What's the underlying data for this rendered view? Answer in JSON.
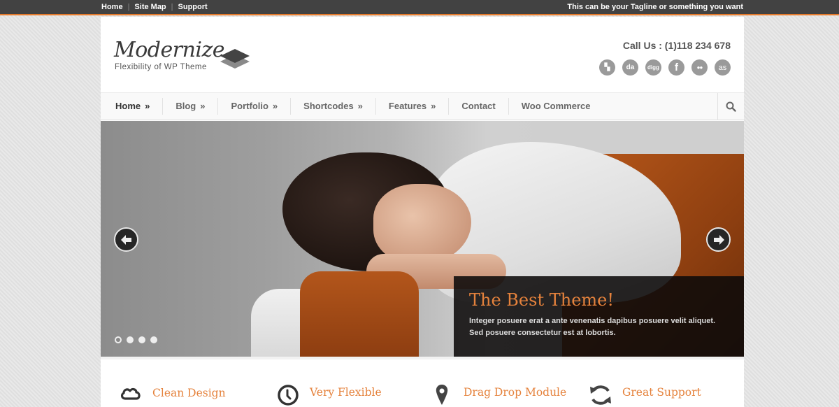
{
  "topbar": {
    "links": [
      "Home",
      "Site Map",
      "Support"
    ],
    "tagline": "This can be your Tagline or something you want"
  },
  "header": {
    "logo": "Modernize",
    "logo_subtitle": "Flexibility of WP Theme",
    "call_us": "Call Us : (1)118 234 678",
    "socials": [
      {
        "name": "delicious-icon",
        "glyph": "▚"
      },
      {
        "name": "deviantart-icon",
        "glyph": "da"
      },
      {
        "name": "digg-icon",
        "glyph": "digg"
      },
      {
        "name": "facebook-icon",
        "glyph": "f"
      },
      {
        "name": "flickr-icon",
        "glyph": "●●"
      },
      {
        "name": "lastfm-icon",
        "glyph": "as"
      }
    ]
  },
  "nav": {
    "items": [
      {
        "label": "Home",
        "submenu": "»"
      },
      {
        "label": "Blog",
        "submenu": "»"
      },
      {
        "label": "Portfolio",
        "submenu": "»"
      },
      {
        "label": "Shortcodes",
        "submenu": "»"
      },
      {
        "label": "Features",
        "submenu": "»"
      },
      {
        "label": "Contact",
        "submenu": ""
      },
      {
        "label": "Woo Commerce",
        "submenu": ""
      }
    ],
    "search_icon": "search-icon"
  },
  "slider": {
    "caption_title": "The Best Theme!",
    "caption_text": "Integer posuere erat a ante venenatis dapibus posuere velit aliquet. Sed posuere consectetur est at lobortis.",
    "slide_count": 4,
    "active_slide": 1
  },
  "features": [
    {
      "icon": "cloud-icon",
      "label": "Clean Design"
    },
    {
      "icon": "clock-icon",
      "label": "Very Flexible"
    },
    {
      "icon": "map-pin-icon",
      "label": "Drag Drop Module"
    },
    {
      "icon": "refresh-icon",
      "label": "Great Support"
    }
  ],
  "colors": {
    "accent": "#e5823c",
    "topbar": "#424242"
  }
}
